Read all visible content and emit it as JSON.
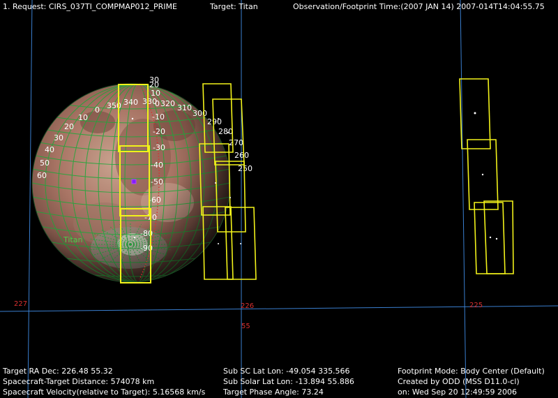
{
  "header": {
    "request": "1. Request:  CIRS_037TI_COMPMAP012_PRIME",
    "target": "Target: Titan",
    "time": "Observation/Footprint Time:(2007 JAN 14)  2007-014T14:04:55.75"
  },
  "target_label": "Titan",
  "grid_labels": {
    "ra_ticks": [
      "227",
      "226",
      "225"
    ],
    "dec_ticks": [
      "55"
    ]
  },
  "longitude_labels": [
    "60",
    "50",
    "40",
    "30",
    "20",
    "10",
    "0",
    "350",
    "340",
    "330",
    "320",
    "310",
    "300",
    "290",
    "280",
    "270",
    "260",
    "250"
  ],
  "latitude_labels": [
    "30",
    "20",
    "10",
    "0",
    "-10",
    "-20",
    "-30",
    "-40",
    "-50",
    "-60",
    "-70",
    "-80",
    "-90"
  ],
  "footer": {
    "col1": [
      "Target RA  Dec:  226.48   55.32",
      "Spacecraft-Target Distance:   574078 km",
      "Spacecraft Velocity(relative to Target):  5.16568 km/s"
    ],
    "col2": [
      "Sub SC Lat Lon:  -49.054   335.566",
      "Sub Solar Lat Lon:  -13.894   55.886",
      "Target Phase Angle:  73.24"
    ],
    "col3": [
      "Footprint Mode: Body Center (Default)",
      "Created by ODD  (MSS D11.0-cl)",
      "on: Wed Sep 20 12:49:59 2006"
    ]
  },
  "colors": {
    "grid_blue": "#3a7fd0",
    "footprint_yellow": "#f2f21a",
    "label_red": "#d93030",
    "planet_grid_green": "#1fa83a",
    "target_label_green": "#4cd04c",
    "marker_magenta": "#c040ff"
  }
}
